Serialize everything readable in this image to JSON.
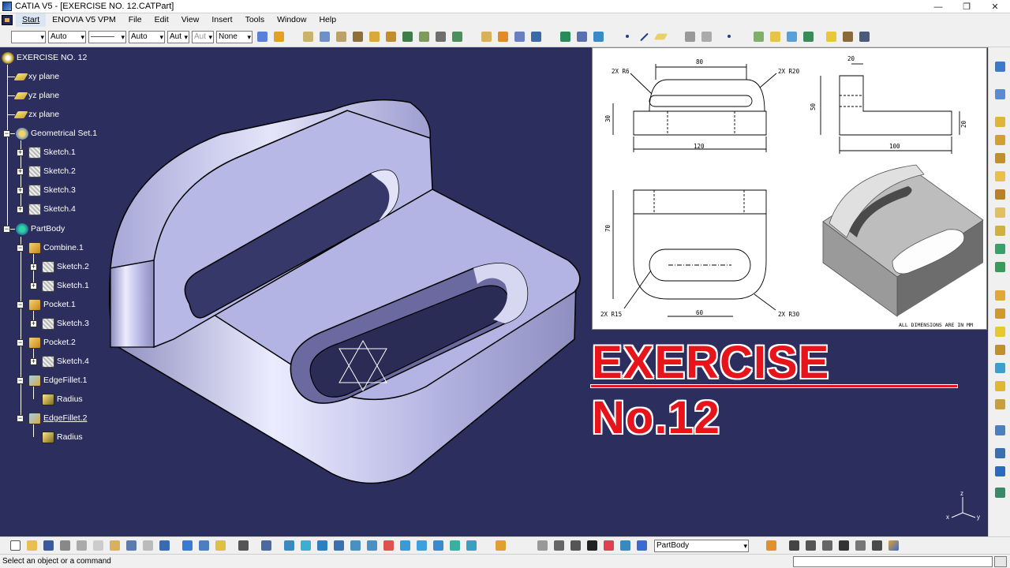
{
  "window": {
    "title": "CATIA V5 - [EXERCISE NO. 12.CATPart]",
    "controls": {
      "minimize": "—",
      "maximize": "❐",
      "close": "✕"
    }
  },
  "menu": [
    "Start",
    "ENOVIA V5 VPM",
    "File",
    "Edit",
    "View",
    "Insert",
    "Tools",
    "Window",
    "Help"
  ],
  "toolbar": {
    "color_combo": "",
    "transparency_combo": "Auto",
    "linetype_combo": "———",
    "thickness_combo": "Auto",
    "point_combo": "Aut",
    "layer_combo_disabled": "Aut",
    "layer_combo": "None"
  },
  "tree": {
    "root": "EXERCISE NO. 12",
    "xy": "xy plane",
    "yz": "yz plane",
    "zx": "zx plane",
    "geoset": "Geometrical Set.1",
    "sk1": "Sketch.1",
    "sk2": "Sketch.2",
    "sk3": "Sketch.3",
    "sk4": "Sketch.4",
    "partbody": "PartBody",
    "combine": "Combine.1",
    "c_sk2": "Sketch.2",
    "c_sk1": "Sketch.1",
    "pocket1": "Pocket.1",
    "p1_sk3": "Sketch.3",
    "pocket2": "Pocket.2",
    "p2_sk4": "Sketch.4",
    "fillet1": "EdgeFillet.1",
    "f1_radius": "Radius",
    "fillet2": "EdgeFillet.2",
    "f2_radius": "Radius"
  },
  "drawing": {
    "dim_80": "80",
    "dim_2x_r6": "2X R6",
    "dim_2x_r20": "2X R20",
    "dim_30": "30",
    "dim_120": "120",
    "dim_20_top": "20",
    "dim_50": "50",
    "dim_20_right": "20",
    "dim_100": "100",
    "dim_70": "70",
    "dim_2x_r15": "2X R15",
    "dim_60": "60",
    "dim_2x_r30": "2X R30",
    "note": "ALL DIMENSIONS ARE IN MM"
  },
  "banner": {
    "text": "EXERCISE No.12"
  },
  "bottom": {
    "current_body": "PartBody"
  },
  "status": {
    "message": "Select an object or a command"
  },
  "axis": {
    "x": "x",
    "y": "y",
    "z": "z"
  },
  "colors": {
    "viewport_bg": "#2c2f5e",
    "part_face": "#b7b7e6",
    "banner_red": "#e8141b"
  }
}
